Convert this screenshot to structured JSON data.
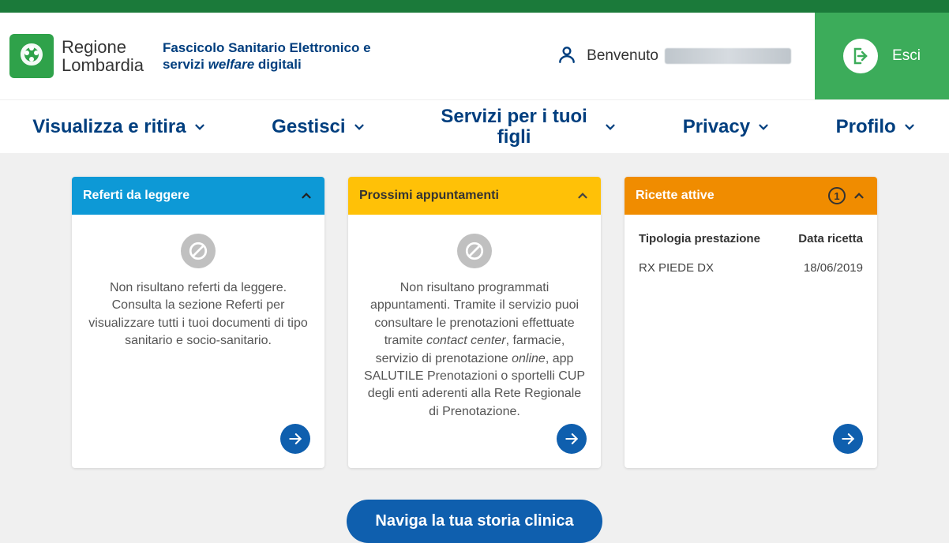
{
  "logo": {
    "line1": "Regione",
    "line2": "Lombardia"
  },
  "tagline_main": "Fascicolo Sanitario Elettronico e servizi ",
  "tagline_em": "welfare",
  "tagline_after": " digitali",
  "welcome_label": "Benvenuto",
  "logout_label": "Esci",
  "nav": [
    {
      "label": "Visualizza e ritira"
    },
    {
      "label": "Gestisci"
    },
    {
      "label": "Servizi per i tuoi figli"
    },
    {
      "label": "Privacy"
    },
    {
      "label": "Profilo"
    }
  ],
  "cards": {
    "referti": {
      "title": "Referti da leggere",
      "message": "Non risultano referti da leggere. Consulta la sezione Referti per visualizzare tutti i tuoi documenti di tipo sanitario e socio-sanitario."
    },
    "appuntamenti": {
      "title": "Prossimi appuntamenti",
      "msg_before": "Non risultano programmati appuntamenti. Tramite il servizio puoi consultare le prenotazioni effettuate tramite ",
      "msg_em1": "contact center",
      "msg_mid": ", farmacie, servizio di prenotazione ",
      "msg_em2": "online",
      "msg_after": ", app SALUTILE Prenotazioni o sportelli CUP degli enti aderenti alla Rete Regionale di Prenotazione."
    },
    "ricette": {
      "title": "Ricette attive",
      "count": "1",
      "col1": "Tipologia prestazione",
      "col2": "Data ricetta",
      "rows": [
        {
          "name": "RX PIEDE DX",
          "date": "18/06/2019"
        }
      ]
    }
  },
  "cta": "Naviga la tua storia clinica"
}
